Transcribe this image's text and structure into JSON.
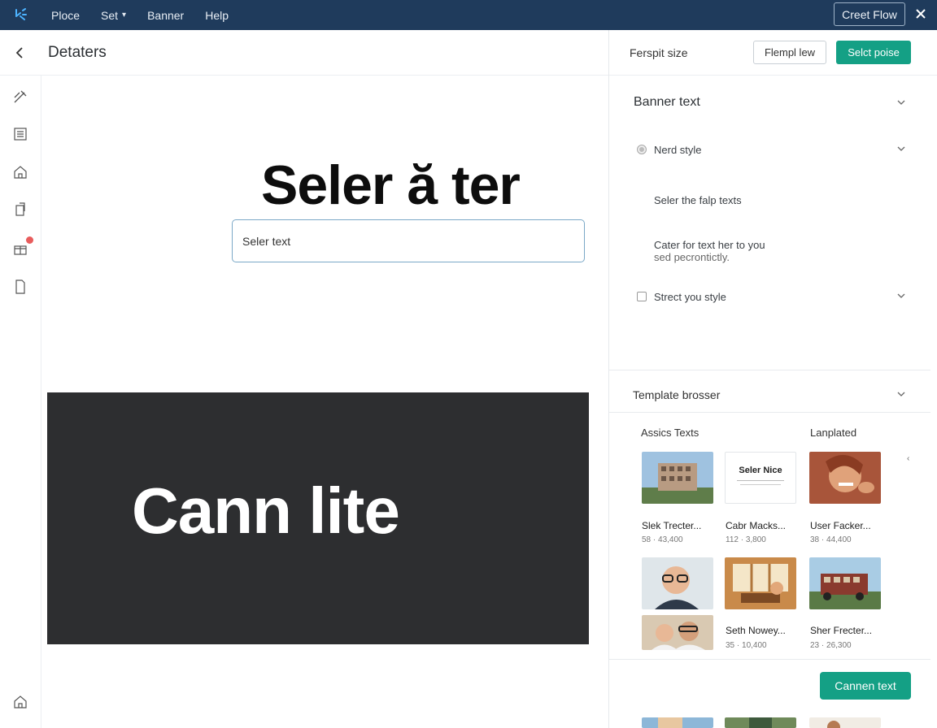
{
  "topbar": {
    "menu": [
      "Ploce",
      "Set",
      "Banner",
      "Help"
    ],
    "create_label": "Creet Flow"
  },
  "header": {
    "title": "Detaters"
  },
  "canvas": {
    "headline": "Seler ă ter",
    "input_value": "Seler text",
    "banner_text": "Cann lite",
    "banner_color": "#2d2e30"
  },
  "right_panel": {
    "head_label": "Ferspit size",
    "outline_button": "Flempl lew",
    "green_button": "Selct poise",
    "banner_section": "Banner text",
    "nerd_style": "Nerd style",
    "hint1": "Seler the falp texts",
    "hint2_line1": "Cater for text her to you",
    "hint2_line2": "sed pecrontictly.",
    "strect_style": "Strect you style",
    "template_section": "Template brosser",
    "col_left": "Assics Texts",
    "col_right": "Lanplated",
    "thumb_text": "Seler Nice",
    "templates": [
      {
        "title": "Slek Trecter...",
        "sub": "58 · 43,400"
      },
      {
        "title": "Cabr Macks...",
        "sub": "112 · 3,800"
      },
      {
        "title": "User Facker...",
        "sub": "38 · 44,400"
      },
      {
        "title": "Seth Nowey...",
        "sub": "35 · 10,400"
      },
      {
        "title": "Sher Frecter...",
        "sub": "23 · 26,300"
      }
    ],
    "bottom_button": "Cannen text"
  },
  "colors": {
    "nav": "#1f3b5c",
    "accent": "#14a085"
  }
}
